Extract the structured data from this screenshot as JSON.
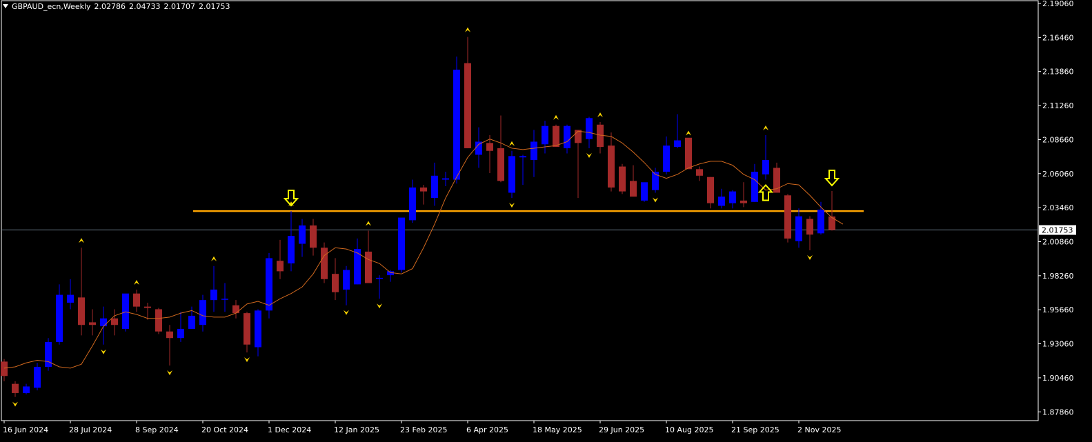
{
  "header": {
    "symbol": "GBPAUD_ecn,Weekly",
    "open": "2.02786",
    "high": "2.04733",
    "low": "2.01707",
    "close": "2.01753"
  },
  "colors": {
    "background": "#000000",
    "bull_candle": "#0000ff",
    "bear_candle": "#a52a2a",
    "wick": "#a52a2a",
    "moving_average": "#d2691e",
    "support_line": "#ffa500",
    "fractal": "#ffd700",
    "arrow": "#ffff00",
    "price_line": "#708090",
    "axis": "#ffffff"
  },
  "chart_data": {
    "type": "candlestick",
    "timeframe": "Weekly",
    "y_ticks": [
      "2.19060",
      "2.16460",
      "2.13860",
      "2.11260",
      "2.08660",
      "2.06060",
      "2.03460",
      "2.00860",
      "1.98260",
      "1.95660",
      "1.93060",
      "1.90460",
      "1.87860"
    ],
    "ylim": [
      1.8719,
      2.1927
    ],
    "x_tick_labels": [
      {
        "label": "16 Jun 2024",
        "index": 0
      },
      {
        "label": "28 Jul 2024",
        "index": 6
      },
      {
        "label": "8 Sep 2024",
        "index": 12
      },
      {
        "label": "20 Oct 2024",
        "index": 18
      },
      {
        "label": "1 Dec 2024",
        "index": 24
      },
      {
        "label": "12 Jan 2025",
        "index": 30
      },
      {
        "label": "23 Feb 2025",
        "index": 36
      },
      {
        "label": "6 Apr 2025",
        "index": 42
      },
      {
        "label": "18 May 2025",
        "index": 48
      },
      {
        "label": "29 Jun 2025",
        "index": 54
      },
      {
        "label": "10 Aug 2025",
        "index": 60
      },
      {
        "label": "21 Sep 2025",
        "index": 66
      },
      {
        "label": "2 Nov 2025",
        "index": 72
      }
    ],
    "candles": [
      {
        "o": 1.917,
        "h": 1.919,
        "l": 1.902,
        "c": 1.906
      },
      {
        "o": 1.9,
        "h": 1.902,
        "l": 1.89,
        "c": 1.893
      },
      {
        "o": 1.893,
        "h": 1.9,
        "l": 1.892,
        "c": 1.898
      },
      {
        "o": 1.897,
        "h": 1.916,
        "l": 1.895,
        "c": 1.913
      },
      {
        "o": 1.913,
        "h": 1.935,
        "l": 1.91,
        "c": 1.932
      },
      {
        "o": 1.932,
        "h": 1.976,
        "l": 1.93,
        "c": 1.968
      },
      {
        "o": 1.962,
        "h": 1.98,
        "l": 1.957,
        "c": 1.968
      },
      {
        "o": 1.966,
        "h": 2.004,
        "l": 1.937,
        "c": 1.945
      },
      {
        "o": 1.947,
        "h": 1.957,
        "l": 1.937,
        "c": 1.945
      },
      {
        "o": 1.944,
        "h": 1.959,
        "l": 1.93,
        "c": 1.95
      },
      {
        "o": 1.95,
        "h": 1.957,
        "l": 1.937,
        "c": 1.945
      },
      {
        "o": 1.942,
        "h": 1.968,
        "l": 1.94,
        "c": 1.969
      },
      {
        "o": 1.969,
        "h": 1.972,
        "l": 1.955,
        "c": 1.959
      },
      {
        "o": 1.959,
        "h": 1.962,
        "l": 1.949,
        "c": 1.958
      },
      {
        "o": 1.957,
        "h": 1.958,
        "l": 1.938,
        "c": 1.94
      },
      {
        "o": 1.94,
        "h": 1.945,
        "l": 1.914,
        "c": 1.935
      },
      {
        "o": 1.935,
        "h": 1.955,
        "l": 1.932,
        "c": 1.942
      },
      {
        "o": 1.942,
        "h": 1.959,
        "l": 1.942,
        "c": 1.952
      },
      {
        "o": 1.945,
        "h": 1.968,
        "l": 1.94,
        "c": 1.964
      },
      {
        "o": 1.964,
        "h": 1.99,
        "l": 1.955,
        "c": 1.972
      },
      {
        "o": 1.965,
        "h": 1.977,
        "l": 1.955,
        "c": 1.965
      },
      {
        "o": 1.96,
        "h": 1.964,
        "l": 1.95,
        "c": 1.954
      },
      {
        "o": 1.954,
        "h": 1.955,
        "l": 1.924,
        "c": 1.93
      },
      {
        "o": 1.928,
        "h": 1.957,
        "l": 1.921,
        "c": 1.956
      },
      {
        "o": 1.956,
        "h": 2.0,
        "l": 1.95,
        "c": 1.996
      },
      {
        "o": 1.994,
        "h": 2.01,
        "l": 1.98,
        "c": 1.986
      },
      {
        "o": 1.992,
        "h": 2.032,
        "l": 1.986,
        "c": 2.013
      },
      {
        "o": 2.007,
        "h": 2.026,
        "l": 1.997,
        "c": 2.021
      },
      {
        "o": 2.021,
        "h": 2.026,
        "l": 1.998,
        "c": 2.004
      },
      {
        "o": 2.004,
        "h": 2.008,
        "l": 1.977,
        "c": 1.98
      },
      {
        "o": 1.984,
        "h": 1.996,
        "l": 1.964,
        "c": 1.97
      },
      {
        "o": 1.972,
        "h": 1.99,
        "l": 1.96,
        "c": 1.987
      },
      {
        "o": 1.976,
        "h": 2.011,
        "l": 1.976,
        "c": 2.003
      },
      {
        "o": 2.001,
        "h": 2.017,
        "l": 1.98,
        "c": 1.977
      },
      {
        "o": 1.981,
        "h": 1.983,
        "l": 1.965,
        "c": 1.981
      },
      {
        "o": 1.983,
        "h": 1.987,
        "l": 1.978,
        "c": 1.986
      },
      {
        "o": 1.987,
        "h": 2.026,
        "l": 1.985,
        "c": 2.027
      },
      {
        "o": 2.025,
        "h": 2.056,
        "l": 2.023,
        "c": 2.05
      },
      {
        "o": 2.05,
        "h": 2.052,
        "l": 2.037,
        "c": 2.047
      },
      {
        "o": 2.042,
        "h": 2.069,
        "l": 2.036,
        "c": 2.059
      },
      {
        "o": 2.056,
        "h": 2.062,
        "l": 2.051,
        "c": 2.057
      },
      {
        "o": 2.056,
        "h": 2.15,
        "l": 2.053,
        "c": 2.14
      },
      {
        "o": 2.145,
        "h": 2.165,
        "l": 2.08,
        "c": 2.08
      },
      {
        "o": 2.075,
        "h": 2.096,
        "l": 2.065,
        "c": 2.085
      },
      {
        "o": 2.084,
        "h": 2.09,
        "l": 2.061,
        "c": 2.078
      },
      {
        "o": 2.08,
        "h": 2.105,
        "l": 2.054,
        "c": 2.055
      },
      {
        "o": 2.046,
        "h": 2.078,
        "l": 2.042,
        "c": 2.074
      },
      {
        "o": 2.073,
        "h": 2.075,
        "l": 2.052,
        "c": 2.074
      },
      {
        "o": 2.071,
        "h": 2.094,
        "l": 2.058,
        "c": 2.085
      },
      {
        "o": 2.083,
        "h": 2.101,
        "l": 2.076,
        "c": 2.097
      },
      {
        "o": 2.097,
        "h": 2.098,
        "l": 2.083,
        "c": 2.081
      },
      {
        "o": 2.08,
        "h": 2.098,
        "l": 2.076,
        "c": 2.097
      },
      {
        "o": 2.094,
        "h": 2.089,
        "l": 2.042,
        "c": 2.084
      },
      {
        "o": 2.087,
        "h": 2.104,
        "l": 2.08,
        "c": 2.103
      },
      {
        "o": 2.098,
        "h": 2.1,
        "l": 2.076,
        "c": 2.081
      },
      {
        "o": 2.082,
        "h": 2.092,
        "l": 2.047,
        "c": 2.05
      },
      {
        "o": 2.066,
        "h": 2.068,
        "l": 2.045,
        "c": 2.047
      },
      {
        "o": 2.055,
        "h": 2.067,
        "l": 2.043,
        "c": 2.043
      },
      {
        "o": 2.04,
        "h": 2.051,
        "l": 2.039,
        "c": 2.054
      },
      {
        "o": 2.048,
        "h": 2.065,
        "l": 2.046,
        "c": 2.062
      },
      {
        "o": 2.062,
        "h": 2.089,
        "l": 2.06,
        "c": 2.082
      },
      {
        "o": 2.081,
        "h": 2.106,
        "l": 2.08,
        "c": 2.086
      },
      {
        "o": 2.088,
        "h": 2.086,
        "l": 2.066,
        "c": 2.064
      },
      {
        "o": 2.064,
        "h": 2.066,
        "l": 2.055,
        "c": 2.059
      },
      {
        "o": 2.058,
        "h": 2.058,
        "l": 2.034,
        "c": 2.038
      },
      {
        "o": 2.036,
        "h": 2.049,
        "l": 2.034,
        "c": 2.043
      },
      {
        "o": 2.038,
        "h": 2.048,
        "l": 2.034,
        "c": 2.047
      },
      {
        "o": 2.04,
        "h": 2.054,
        "l": 2.035,
        "c": 2.038
      },
      {
        "o": 2.039,
        "h": 2.068,
        "l": 2.039,
        "c": 2.062
      },
      {
        "o": 2.06,
        "h": 2.09,
        "l": 2.056,
        "c": 2.071
      },
      {
        "o": 2.065,
        "h": 2.069,
        "l": 2.047,
        "c": 2.046
      },
      {
        "o": 2.044,
        "h": 2.045,
        "l": 2.008,
        "c": 2.011
      },
      {
        "o": 2.009,
        "h": 2.034,
        "l": 2.004,
        "c": 2.028
      },
      {
        "o": 2.026,
        "h": 2.028,
        "l": 2.002,
        "c": 2.014
      },
      {
        "o": 2.015,
        "h": 2.039,
        "l": 2.014,
        "c": 2.033
      },
      {
        "o": 2.02786,
        "h": 2.04733,
        "l": 2.01707,
        "c": 2.01753
      }
    ],
    "moving_average": [
      1.912,
      1.913,
      1.916,
      1.918,
      1.917,
      1.913,
      1.912,
      1.915,
      1.929,
      1.944,
      1.952,
      1.955,
      1.953,
      1.95,
      1.95,
      1.951,
      1.954,
      1.956,
      1.952,
      1.951,
      1.951,
      1.954,
      1.961,
      1.963,
      1.96,
      1.965,
      1.969,
      1.974,
      1.984,
      1.998,
      2.004,
      2.003,
      2.0,
      1.995,
      1.992,
      1.985,
      1.984,
      1.988,
      2.004,
      2.022,
      2.042,
      2.058,
      2.073,
      2.083,
      2.087,
      2.084,
      2.08,
      2.079,
      2.08,
      2.081,
      2.082,
      2.085,
      2.093,
      2.092,
      2.09,
      2.089,
      2.084,
      2.077,
      2.069,
      2.06,
      2.057,
      2.06,
      2.065,
      2.068,
      2.07,
      2.07,
      2.067,
      2.06,
      2.056,
      2.048,
      2.049,
      2.053,
      2.052,
      2.044,
      2.035,
      2.027,
      2.022
    ],
    "support_level": 2.032,
    "support_range": [
      18,
      76
    ],
    "current_price": 2.01753,
    "current_price_label": "2.01753",
    "fractals_up": [
      7,
      12,
      19,
      26,
      33,
      42,
      46,
      50,
      54,
      62,
      69
    ],
    "fractals_down": [
      1,
      9,
      15,
      22,
      31,
      34,
      46,
      53,
      59,
      73
    ],
    "signal_arrows": [
      {
        "index": 26,
        "direction": "down"
      },
      {
        "index": 75,
        "direction": "down"
      },
      {
        "index": 69,
        "direction": "up"
      }
    ]
  }
}
